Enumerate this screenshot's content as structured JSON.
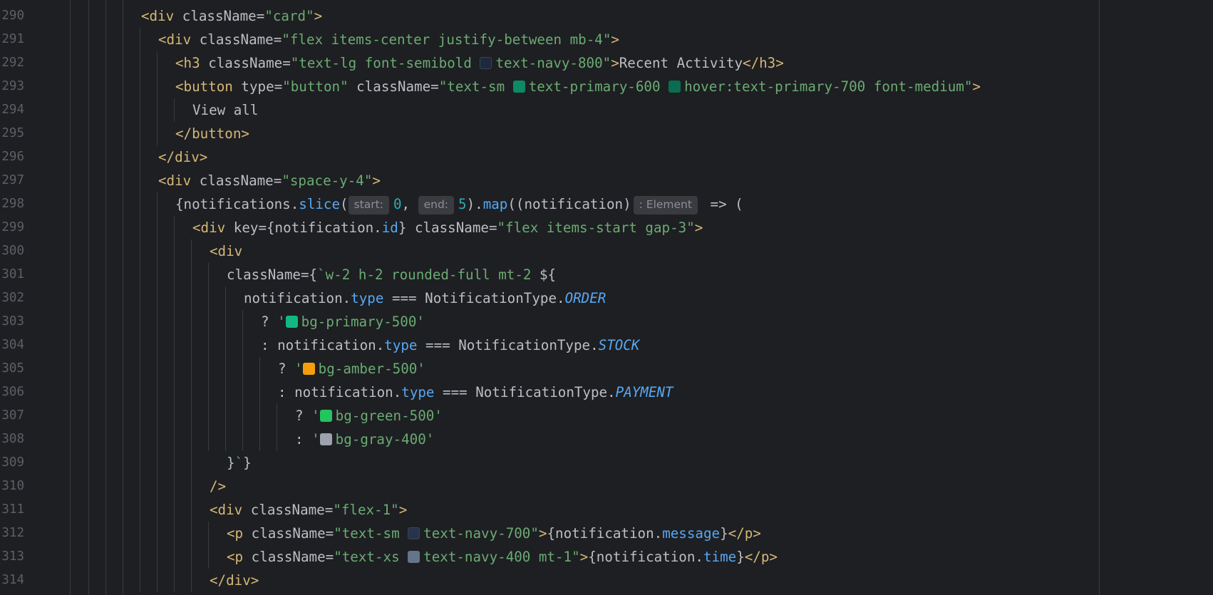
{
  "line_numbers": [
    "290",
    "291",
    "292",
    "293",
    "294",
    "295",
    "296",
    "297",
    "298",
    "299",
    "300",
    "301",
    "302",
    "303",
    "304",
    "305",
    "306",
    "307",
    "308",
    "309",
    "310",
    "311",
    "312",
    "313",
    "314"
  ],
  "colors": {
    "background": "#1e1f22",
    "navy_800": "#1e293b",
    "primary_600": "#0d8a63",
    "primary_700": "#0a6d50",
    "primary_500": "#10b981",
    "amber_500": "#f59e0b",
    "green_500": "#22c55e",
    "gray_400": "#9ca3af",
    "navy_700": "#273449",
    "navy_400": "#64748b"
  },
  "code": {
    "l290": {
      "t1": "<div",
      "a1": " className",
      "eq": "=",
      "s1": "\"card\"",
      "t2": ">"
    },
    "l291": {
      "t1": "<div",
      "a1": " className",
      "eq": "=",
      "s1": "\"flex items-center justify-between mb-4\"",
      "t2": ">"
    },
    "l292": {
      "t1": "<h3",
      "a1": " className",
      "eq": "=",
      "s1": "\"text-lg font-semibold ",
      "s2": "text-navy-800\"",
      "t2": ">",
      "txt": "Recent Activity",
      "t3": "</h3>"
    },
    "l293": {
      "t1": "<button",
      "a1": " type",
      "eq1": "=",
      "s1": "\"button\"",
      "a2": " className",
      "eq2": "=",
      "s2": "\"text-sm ",
      "s3": "text-primary-600 ",
      "s4": "hover:text-primary-700 font-medium\"",
      "t2": ">"
    },
    "l294": {
      "txt": "View all"
    },
    "l295": {
      "t1": "</button>"
    },
    "l296": {
      "t1": "</div>"
    },
    "l297": {
      "t1": "<div",
      "a1": " className",
      "eq": "=",
      "s1": "\"space-y-4\"",
      "t2": ">"
    },
    "l298": {
      "p1": "{notifications.",
      "f1": "slice",
      "p2": "(",
      "h1": "start:",
      "n1": "0",
      "p3": ", ",
      "h2": "end:",
      "n2": "5",
      "p4": ").",
      "f2": "map",
      "p5": "((notification)",
      "h3": ": Element",
      "p6": " => ("
    },
    "l299": {
      "t1": "<div",
      "a1": " key",
      "eq1": "=",
      "p1": "{notification.",
      "pr1": "id",
      "p2": "}",
      "a2": " className",
      "eq2": "=",
      "s1": "\"flex items-start gap-3\"",
      "t2": ">"
    },
    "l300": {
      "t1": "<div"
    },
    "l301": {
      "a1": "className",
      "eq": "=",
      "p1": "{",
      "s1": "`w-2 h-2 rounded-full mt-2 ",
      "p2": "${"
    },
    "l302": {
      "p1": "notification.",
      "pr1": "type",
      "p2": " === NotificationType.",
      "c1": "ORDER"
    },
    "l303": {
      "p1": "? ",
      "s1": "'",
      "s2": "bg-primary-500'"
    },
    "l304": {
      "p1": ": notification.",
      "pr1": "type",
      "p2": " === NotificationType.",
      "c1": "STOCK"
    },
    "l305": {
      "p1": "? ",
      "s1": "'",
      "s2": "bg-amber-500'"
    },
    "l306": {
      "p1": ": notification.",
      "pr1": "type",
      "p2": " === NotificationType.",
      "c1": "PAYMENT"
    },
    "l307": {
      "p1": "? ",
      "s1": "'",
      "s2": "bg-green-500'"
    },
    "l308": {
      "p1": ": ",
      "s1": "'",
      "s2": "bg-gray-400'"
    },
    "l309": {
      "p1": "}",
      "s1": "`",
      "p2": "}"
    },
    "l310": {
      "t1": "/>"
    },
    "l311": {
      "t1": "<div",
      "a1": " className",
      "eq": "=",
      "s1": "\"flex-1\"",
      "t2": ">"
    },
    "l312": {
      "t1": "<p",
      "a1": " className",
      "eq": "=",
      "s1": "\"text-sm ",
      "s2": "text-navy-700\"",
      "t2": ">",
      "p1": "{notification.",
      "pr1": "message",
      "p2": "}",
      "t3": "</p>"
    },
    "l313": {
      "t1": "<p",
      "a1": " className",
      "eq": "=",
      "s1": "\"text-xs ",
      "s2": "text-navy-400 mt-1\"",
      "t2": ">",
      "p1": "{notification.",
      "pr1": "time",
      "p2": "}",
      "t3": "</p>"
    },
    "l314": {
      "t1": "</div>"
    }
  }
}
